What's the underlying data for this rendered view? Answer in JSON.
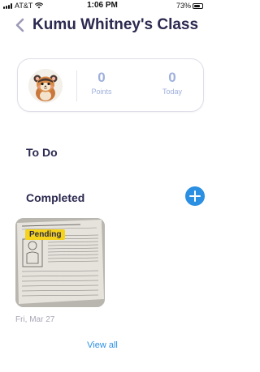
{
  "status_bar": {
    "carrier": "AT&T",
    "time": "1:06 PM",
    "battery": "73%",
    "battery_level": 0.73
  },
  "header": {
    "title": "Kumu Whitney's Class"
  },
  "stats": {
    "points_value": "0",
    "points_label": "Points",
    "today_value": "0",
    "today_label": "Today"
  },
  "sections": {
    "todo_title": "To Do",
    "completed_title": "Completed"
  },
  "completed_items": [
    {
      "status": "Pending",
      "date": "Fri, Mar 27"
    }
  ],
  "view_all_label": "View all",
  "colors": {
    "title": "#2c2a50",
    "accent": "#2b8fe2",
    "pending": "#f5d21b",
    "stat": "#9fb0dd"
  },
  "icons": {
    "back": "chevron-left-icon",
    "add": "plus-circle-icon",
    "avatar": "hamster-avatar"
  }
}
